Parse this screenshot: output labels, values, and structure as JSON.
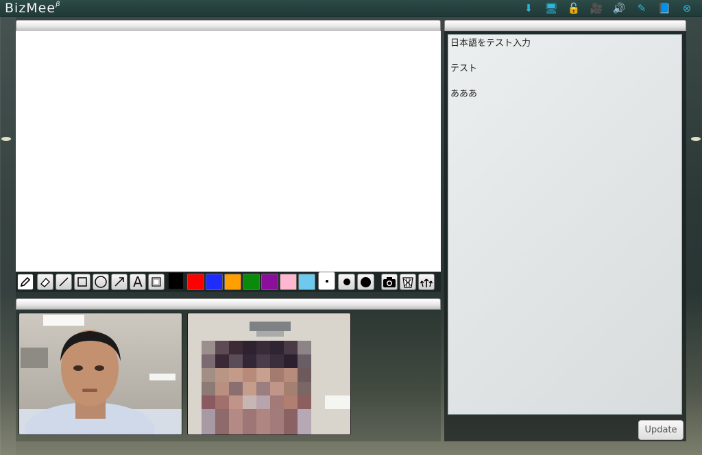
{
  "app": {
    "name": "BizMee",
    "version_mark": "β"
  },
  "top_icons": [
    {
      "name": "download-icon",
      "glyph": "⬇"
    },
    {
      "name": "monitor-icon",
      "glyph": "🖥"
    },
    {
      "name": "unlock-icon",
      "glyph": "🔓"
    },
    {
      "name": "video-camera-icon",
      "glyph": "🎥"
    },
    {
      "name": "speaker-icon",
      "glyph": "🔊"
    },
    {
      "name": "edit-note-icon",
      "glyph": "✎"
    },
    {
      "name": "book-icon",
      "glyph": "📘"
    },
    {
      "name": "close-circle-icon",
      "glyph": "⊗"
    }
  ],
  "top_icon_color": "#2fb3d6",
  "whiteboard": {
    "tools": [
      {
        "name": "pen-tool",
        "icon": "pencil-icon",
        "selected": true
      },
      {
        "name": "eraser-tool",
        "icon": "eraser-icon",
        "selected": false
      },
      {
        "name": "line-tool",
        "icon": "line-icon",
        "selected": false
      },
      {
        "name": "rectangle-tool",
        "icon": "square-icon",
        "selected": false
      },
      {
        "name": "circle-tool",
        "icon": "circle-icon",
        "selected": false
      },
      {
        "name": "arrow-tool",
        "icon": "arrow-icon",
        "selected": false
      },
      {
        "name": "text-tool",
        "icon": "text-a-icon",
        "label": "A",
        "selected": false
      },
      {
        "name": "textbox-tool",
        "icon": "textbox-icon",
        "selected": false
      }
    ],
    "colors": [
      {
        "name": "black",
        "hex": "#000000",
        "selected": true
      },
      {
        "name": "red",
        "hex": "#ff0000",
        "selected": false
      },
      {
        "name": "blue",
        "hex": "#1e2cff",
        "selected": false
      },
      {
        "name": "orange",
        "hex": "#ff9f00",
        "selected": false
      },
      {
        "name": "green",
        "hex": "#0a8a0a",
        "selected": false
      },
      {
        "name": "purple",
        "hex": "#8a0f9a",
        "selected": false
      },
      {
        "name": "pink",
        "hex": "#ffb7cf",
        "selected": false
      },
      {
        "name": "light-blue",
        "hex": "#6ec9ee",
        "selected": false
      }
    ],
    "sizes": [
      {
        "name": "small",
        "selected": true
      },
      {
        "name": "medium",
        "selected": false
      },
      {
        "name": "large",
        "selected": false
      }
    ],
    "actions": [
      {
        "name": "snapshot-button",
        "icon": "camera-icon"
      },
      {
        "name": "clear-button",
        "icon": "trash-basket-icon"
      },
      {
        "name": "undo-button",
        "icon": "scatter-arrows-icon"
      }
    ]
  },
  "videos": [
    {
      "name": "video-participant-1",
      "pixelated": false
    },
    {
      "name": "video-participant-2",
      "pixelated": true
    }
  ],
  "chat": {
    "lines": [
      "日本語をテスト入力",
      "テスト",
      "あああ"
    ],
    "update_label": "Update"
  }
}
